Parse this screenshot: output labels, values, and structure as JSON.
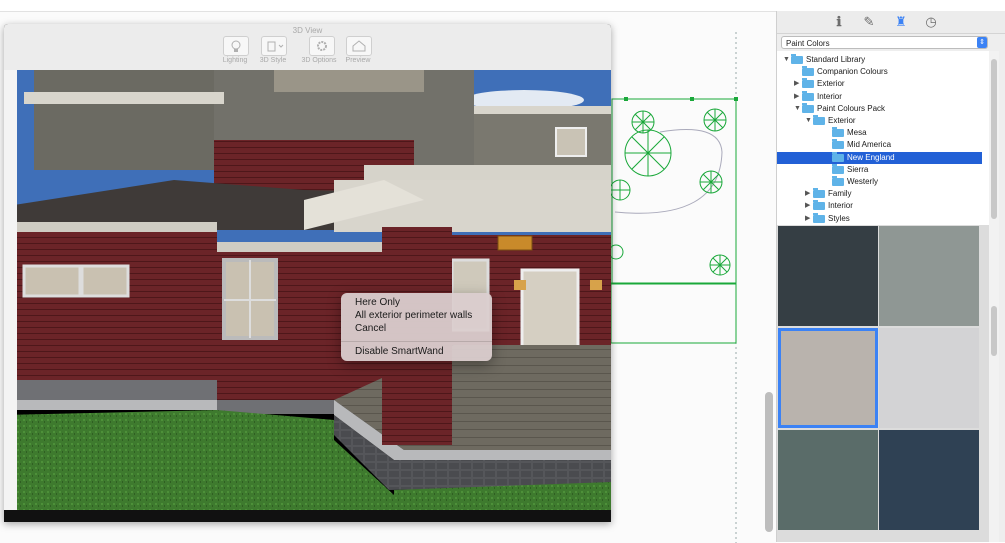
{
  "view3d": {
    "title": "3D View",
    "toolbar": [
      {
        "label": "Lighting",
        "icon": "bulb-icon"
      },
      {
        "label": "3D Style",
        "icon": "style-icon"
      },
      {
        "label": "3D Options",
        "icon": "gear-icon"
      },
      {
        "label": "Preview",
        "icon": "house-icon"
      }
    ]
  },
  "context_menu": {
    "items": [
      "Here Only",
      "All exterior perimeter walls",
      "Cancel"
    ],
    "extra": "Disable SmartWand"
  },
  "right_panel": {
    "tabs": [
      {
        "glyph": "ℹ",
        "icon": "info-icon"
      },
      {
        "glyph": "✎",
        "icon": "tag-icon"
      },
      {
        "glyph": "♜",
        "icon": "chair-icon"
      },
      {
        "glyph": "◷",
        "icon": "timer-icon"
      }
    ],
    "library_select": "Paint Colors",
    "tree": [
      {
        "label": "Standard Library",
        "level": 0,
        "toggle": "▼"
      },
      {
        "label": "Companion Colours",
        "level": 1,
        "toggle": ""
      },
      {
        "label": "Exterior",
        "level": 1,
        "toggle": "▶"
      },
      {
        "label": "Interior",
        "level": 1,
        "toggle": "▶"
      },
      {
        "label": "Paint Colours Pack",
        "level": 1,
        "toggle": "▼"
      },
      {
        "label": "Exterior",
        "level": 2,
        "toggle": "▼"
      },
      {
        "label": "Mesa",
        "level": 3,
        "toggle": ""
      },
      {
        "label": "Mid America",
        "level": 3,
        "toggle": ""
      },
      {
        "label": "New England",
        "level": 3,
        "toggle": "",
        "selected": true
      },
      {
        "label": "Sierra",
        "level": 3,
        "toggle": ""
      },
      {
        "label": "Westerly",
        "level": 3,
        "toggle": ""
      },
      {
        "label": "Family",
        "level": 2,
        "toggle": "▶"
      },
      {
        "label": "Interior",
        "level": 2,
        "toggle": "▶"
      },
      {
        "label": "Styles",
        "level": 2,
        "toggle": "▶"
      }
    ],
    "swatches": [
      "#353e44",
      "#8f9794",
      "#b9b3ad",
      "#d3d3d5",
      "#5a6c69",
      "#2f4154"
    ],
    "selected_swatch": 2
  },
  "colors": {
    "selection": "#2260d6",
    "accent": "#3b82f5",
    "plan_green": "#1aa83a"
  }
}
